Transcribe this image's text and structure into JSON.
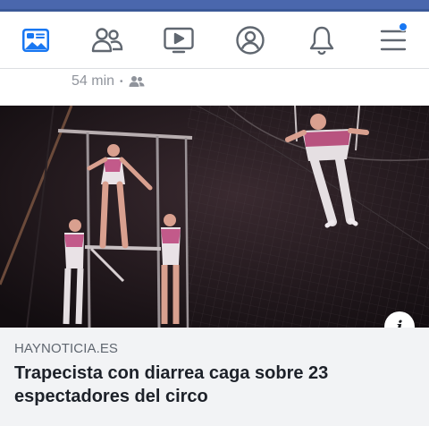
{
  "navbar": {
    "items": [
      {
        "name": "news-feed",
        "icon": "news-feed-icon",
        "active": true
      },
      {
        "name": "friends",
        "icon": "friends-icon"
      },
      {
        "name": "watch",
        "icon": "watch-icon"
      },
      {
        "name": "profile",
        "icon": "profile-icon"
      },
      {
        "name": "notifications",
        "icon": "bell-icon"
      },
      {
        "name": "menu",
        "icon": "hamburger-menu-icon",
        "badge": true
      }
    ],
    "accent_color": "#1877f2",
    "icon_color": "#606770"
  },
  "post": {
    "time_ago": "54 min",
    "separator": "•",
    "audience_icon": "friends-audience-icon",
    "image": {
      "description_icon": "trapeze-photo",
      "info_button_label": "i"
    },
    "link": {
      "domain": "HAYNOTICIA.ES",
      "title": "Trapecista con diarrea caga sobre 23 espectadores del circo"
    }
  }
}
